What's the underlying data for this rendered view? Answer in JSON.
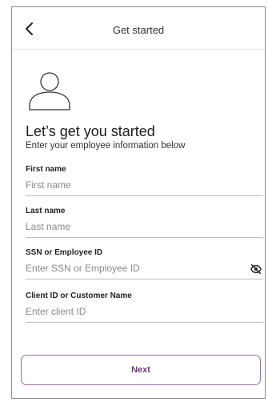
{
  "header": {
    "title": "Get started"
  },
  "intro": {
    "title": "Let’s get you started",
    "subtitle": "Enter your employee information below"
  },
  "fields": [
    {
      "label": "First name",
      "placeholder": "First name",
      "value": ""
    },
    {
      "label": "Last name",
      "placeholder": "Last name",
      "value": ""
    },
    {
      "label": "SSN or Employee ID",
      "placeholder": "Enter SSN or Employee ID",
      "value": ""
    },
    {
      "label": "Client ID or Customer Name",
      "placeholder": "Enter client ID",
      "value": ""
    }
  ],
  "buttons": {
    "next_label": "Next"
  },
  "icons": {
    "back": "chevron-left-icon",
    "avatar": "user-icon",
    "toggle_visibility": "eye-slash-icon"
  },
  "colors": {
    "accent": "#6d3a7b",
    "button_border": "#9b6ea9",
    "field_underline": "#bdbdbd"
  }
}
